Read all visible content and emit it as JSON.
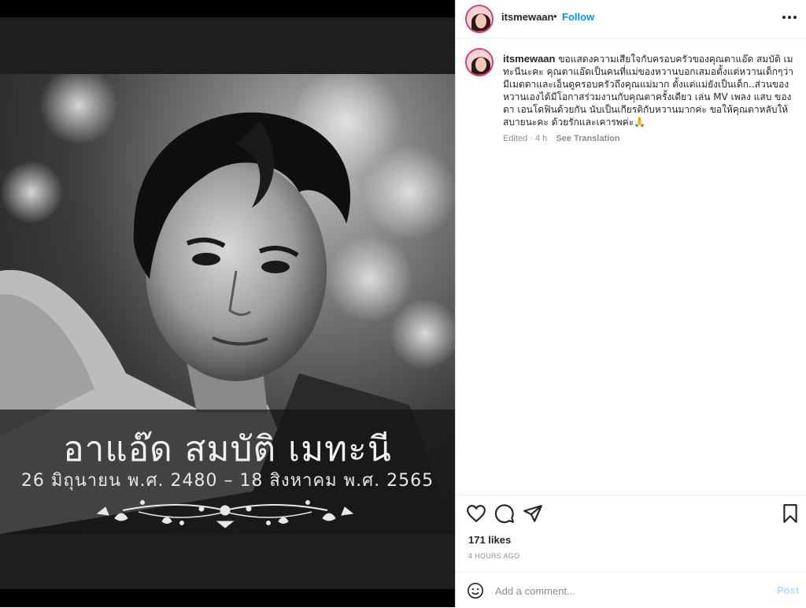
{
  "post": {
    "memorial_name": "อาแอ๊ด สมบัติ เมทะนี",
    "memorial_dates": "26 มิถุนายน พ.ศ. 2480 – 18 สิงหาคม พ.ศ. 2565"
  },
  "header": {
    "username": "itsmewaan",
    "separator": "•",
    "follow_label": "Follow",
    "more_icon": "more-horizontal-icon"
  },
  "caption": {
    "username": "itsmewaan",
    "text": "ขอแสดงความเสียใจกับครอบครัวของคุณตาแอ๊ด สมบัติ เมทะนีนะคะ คุณตาแอ๊ดเป็นคนที่แม่ของหวานบอกเสมอตั้งแต่หวานเด็กๆว่ามีเมตตาและเอ็นดูครอบครัวถึงคุณแม่มาก ตั้งแต่แม่ยังเป็นเด็ก..ส่วนของหวานเองได้มีโอกาสร่วมงานกับคุณตาครั้งเดียว เล่น MV เพลง แสบ ของดา เอนโดฟินด้วยกัน นับเป็นเกียรติกับหวานมากค่ะ ขอให้คุณตาหลับให้สบายนะคะ ด้วยรักและเคารพค่ะ🙏",
    "edited": "Edited · 4 h",
    "see_translation": "See Translation"
  },
  "actions": {
    "like_icon": "heart-icon",
    "comment_icon": "comment-icon",
    "share_icon": "share-icon",
    "save_icon": "bookmark-icon"
  },
  "likes": "171 likes",
  "timestamp": "4 HOURS AGO",
  "comment_box": {
    "emoji_icon": "emoji-icon",
    "placeholder": "Add a comment...",
    "post_label": "Post"
  },
  "colors": {
    "accent": "#0095f6",
    "post_disabled": "#b2dffc",
    "text": "#262626",
    "muted": "#8e8e8e"
  }
}
